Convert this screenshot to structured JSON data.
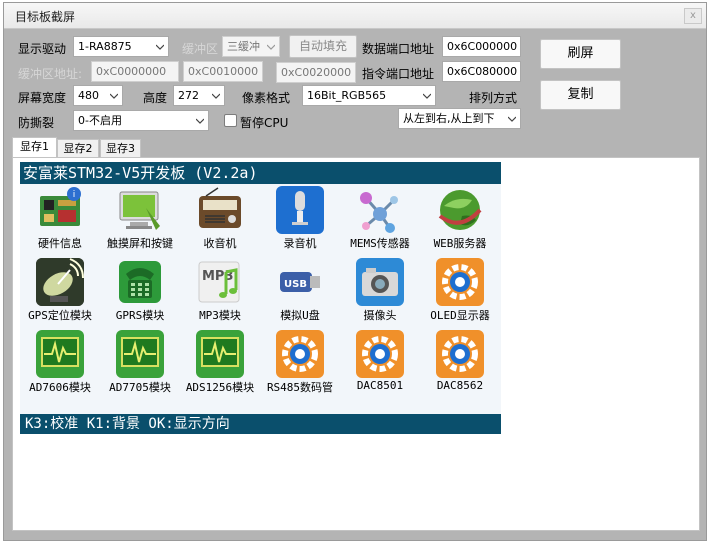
{
  "window": {
    "title": "目标板截屏",
    "close_label": "x"
  },
  "form": {
    "driver_label": "显示驱动",
    "driver_value": "1-RA8875",
    "buffer_label": "缓冲区",
    "buffer_value": "三缓冲",
    "autofill_label": "自动填充",
    "data_port_label": "数据端口地址",
    "data_port_value": "0x6C000000",
    "buffer_addr_label": "缓冲区地址:",
    "buffer_addr1": "0xC0000000",
    "buffer_addr2": "0xC0010000",
    "buffer_addr3": "0xC0020000",
    "cmd_port_label": "指令端口地址",
    "cmd_port_value": "0x6C080000",
    "width_label": "屏幕宽度",
    "width_value": "480",
    "height_label": "高度",
    "height_value": "272",
    "pixel_label": "像素格式",
    "pixel_value": "16Bit_RGB565",
    "order_label": "排列方式",
    "order_value": "从左到右,从上到下",
    "tear_label": "防撕裂",
    "tear_value": "0-不启用",
    "pause_label": "暂停CPU",
    "refresh_label": "刷屏",
    "copy_label": "复制"
  },
  "tabs": [
    "显存1",
    "显存2",
    "显存3"
  ],
  "lcd": {
    "title": "安富莱STM32-V5开发板  (V2.2a)",
    "footer": "K3:校准 K1:背景 OK:显示方向",
    "apps": [
      {
        "name": "硬件信息",
        "icon": "hardware-info-icon"
      },
      {
        "name": "触摸屏和按键",
        "icon": "touch-screen-icon"
      },
      {
        "name": "收音机",
        "icon": "radio-icon"
      },
      {
        "name": "录音机",
        "icon": "microphone-icon"
      },
      {
        "name": "MEMS传感器",
        "icon": "sensor-icon"
      },
      {
        "name": "WEB服务器",
        "icon": "web-globe-icon"
      },
      {
        "name": "GPS定位模块",
        "icon": "gps-dish-icon"
      },
      {
        "name": "GPRS模块",
        "icon": "phone-icon"
      },
      {
        "name": "MP3模块",
        "icon": "mp3-icon"
      },
      {
        "name": "模拟U盘",
        "icon": "usb-drive-icon"
      },
      {
        "name": "摄像头",
        "icon": "camera-icon"
      },
      {
        "name": "OLED显示器",
        "icon": "gear-icon"
      },
      {
        "name": "AD7606模块",
        "icon": "oscilloscope-icon"
      },
      {
        "name": "AD7705模块",
        "icon": "oscilloscope-icon"
      },
      {
        "name": "ADS1256模块",
        "icon": "oscilloscope-icon"
      },
      {
        "name": "RS485数码管",
        "icon": "gear-icon"
      },
      {
        "name": "DAC8501",
        "icon": "gear-icon"
      },
      {
        "name": "DAC8562",
        "icon": "gear-icon"
      }
    ]
  }
}
